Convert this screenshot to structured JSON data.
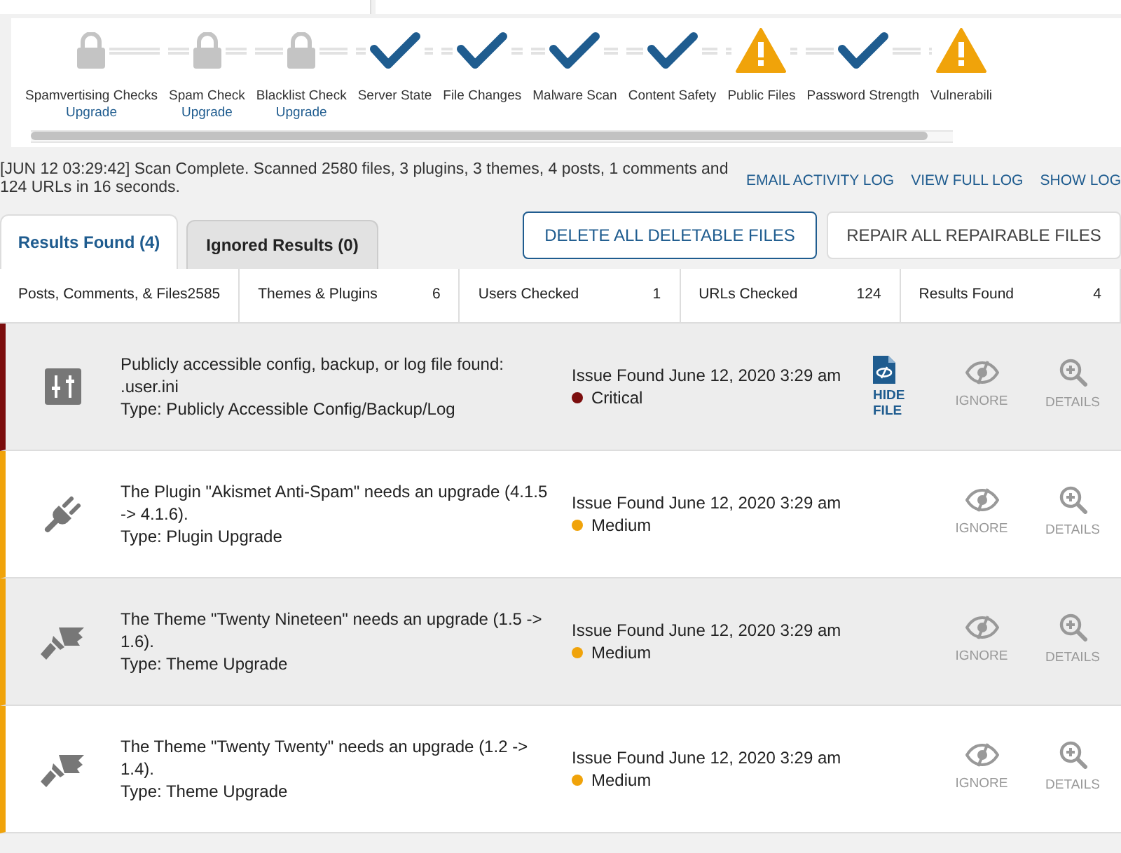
{
  "steps": [
    {
      "kind": "locked",
      "label": "Spamvertising Checks",
      "link": "Upgrade"
    },
    {
      "kind": "locked",
      "label": "Spam Check",
      "link": "Upgrade"
    },
    {
      "kind": "locked",
      "label": "Blacklist Check",
      "link": "Upgrade"
    },
    {
      "kind": "passed",
      "label": "Server State"
    },
    {
      "kind": "passed",
      "label": "File Changes"
    },
    {
      "kind": "passed",
      "label": "Malware Scan"
    },
    {
      "kind": "passed",
      "label": "Content Safety"
    },
    {
      "kind": "warning",
      "label": "Public Files"
    },
    {
      "kind": "passed",
      "label": "Password Strength"
    },
    {
      "kind": "warning",
      "label": "Vulnerabili"
    }
  ],
  "scan_log": "[JUN 12 03:29:42] Scan Complete. Scanned 2580 files, 3 plugins, 3 themes, 4 posts, 1 comments and 124 URLs in 16 seconds.",
  "log_links": [
    "EMAIL ACTIVITY LOG",
    "VIEW FULL LOG",
    "SHOW LOG"
  ],
  "tabs": [
    {
      "label": "Results Found (4)",
      "selected": true
    },
    {
      "label": "Ignored Results (0)",
      "selected": false
    }
  ],
  "buttons": [
    {
      "label": "DELETE ALL DELETABLE FILES",
      "primary": true
    },
    {
      "label": "REPAIR ALL REPAIRABLE FILES",
      "primary": false
    }
  ],
  "stats": [
    {
      "label": "Posts, Comments, & Files",
      "value": "2585"
    },
    {
      "label": "Themes & Plugins",
      "value": "6"
    },
    {
      "label": "Users Checked",
      "value": "1"
    },
    {
      "label": "URLs Checked",
      "value": "124"
    },
    {
      "label": "Results Found",
      "value": "4"
    }
  ],
  "issues": [
    {
      "kind": "config",
      "title": "Publicly accessible config, backup, or log file found: .user.ini",
      "type": "Type: Publicly Accessible Config/Backup/Log",
      "found": "Issue Found June 12, 2020 3:29 am",
      "severity": "Critical",
      "color": "#7b0d0d",
      "hide_action": "HIDE FILE",
      "ignore": "IGNORE",
      "details": "DETAILS"
    },
    {
      "kind": "plugin",
      "title": "The Plugin \"Akismet Anti-Spam\" needs an upgrade (4.1.5 -> 4.1.6).",
      "type": "Type: Plugin Upgrade",
      "found": "Issue Found June 12, 2020 3:29 am",
      "severity": "Medium",
      "color": "#f0a30a",
      "ignore": "IGNORE",
      "details": "DETAILS"
    },
    {
      "kind": "theme",
      "title": "The Theme \"Twenty Nineteen\" needs an upgrade (1.5 -> 1.6).",
      "type": "Type: Theme Upgrade",
      "found": "Issue Found June 12, 2020 3:29 am",
      "severity": "Medium",
      "color": "#f0a30a",
      "ignore": "IGNORE",
      "details": "DETAILS"
    },
    {
      "kind": "theme",
      "title": "The Theme \"Twenty Twenty\" needs an upgrade (1.2 -> 1.4).",
      "type": "Type: Theme Upgrade",
      "found": "Issue Found June 12, 2020 3:29 am",
      "severity": "Medium",
      "color": "#f0a30a",
      "ignore": "IGNORE",
      "details": "DETAILS"
    }
  ]
}
